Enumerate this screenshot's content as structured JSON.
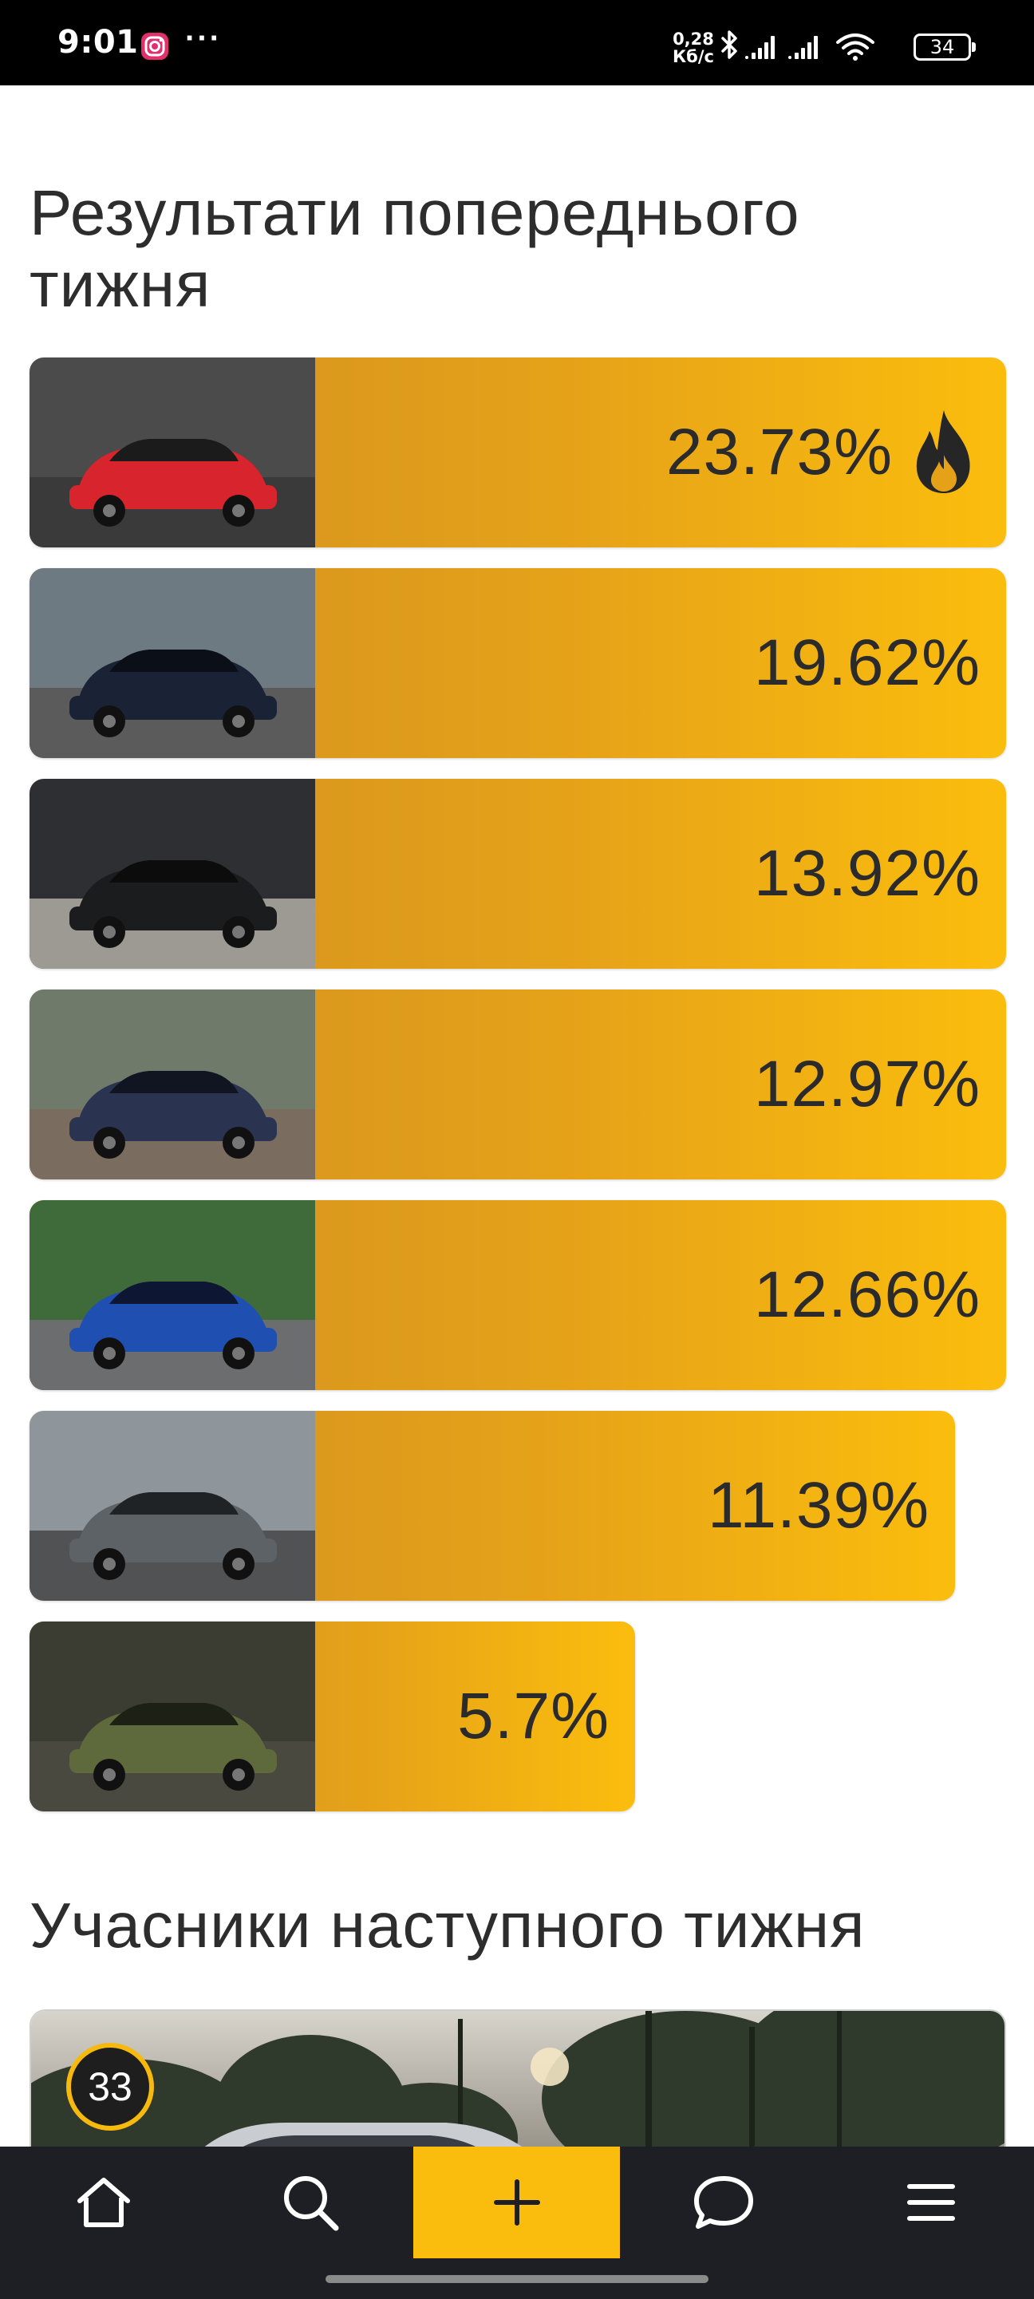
{
  "status_bar": {
    "time": "9:01",
    "net_speed_value": "0,28",
    "net_speed_unit": "Кб/с",
    "battery": "34",
    "more": "···"
  },
  "sections": {
    "previous_week_title": "Результати попереднього тижня",
    "next_week_title": "Учасники наступного тижня"
  },
  "results": [
    {
      "percent": "23.73%",
      "value": 23.73,
      "leader": true,
      "car": "red sedan"
    },
    {
      "percent": "19.62%",
      "value": 19.62,
      "leader": false,
      "car": "dark blue coupe"
    },
    {
      "percent": "13.92%",
      "value": 13.92,
      "leader": false,
      "car": "black hatchback"
    },
    {
      "percent": "12.97%",
      "value": 12.97,
      "leader": false,
      "car": "dark blue sedan"
    },
    {
      "percent": "12.66%",
      "value": 12.66,
      "leader": false,
      "car": "blue sedan"
    },
    {
      "percent": "11.39%",
      "value": 11.39,
      "leader": false,
      "car": "grey sedan"
    },
    {
      "percent": "5.7%",
      "value": 5.7,
      "leader": false,
      "car": "green off-roader"
    }
  ],
  "next_week": {
    "badge_number": "33"
  },
  "bottom_nav": {
    "items": [
      {
        "icon": "home-icon"
      },
      {
        "icon": "search-icon"
      },
      {
        "icon": "plus-icon"
      },
      {
        "icon": "chat-icon"
      },
      {
        "icon": "menu-icon"
      }
    ]
  },
  "colors": {
    "accent": "#fbbd0d",
    "bar_start": "#d08e22",
    "nav_bg": "#1d1f24",
    "status_bg": "#000000"
  }
}
